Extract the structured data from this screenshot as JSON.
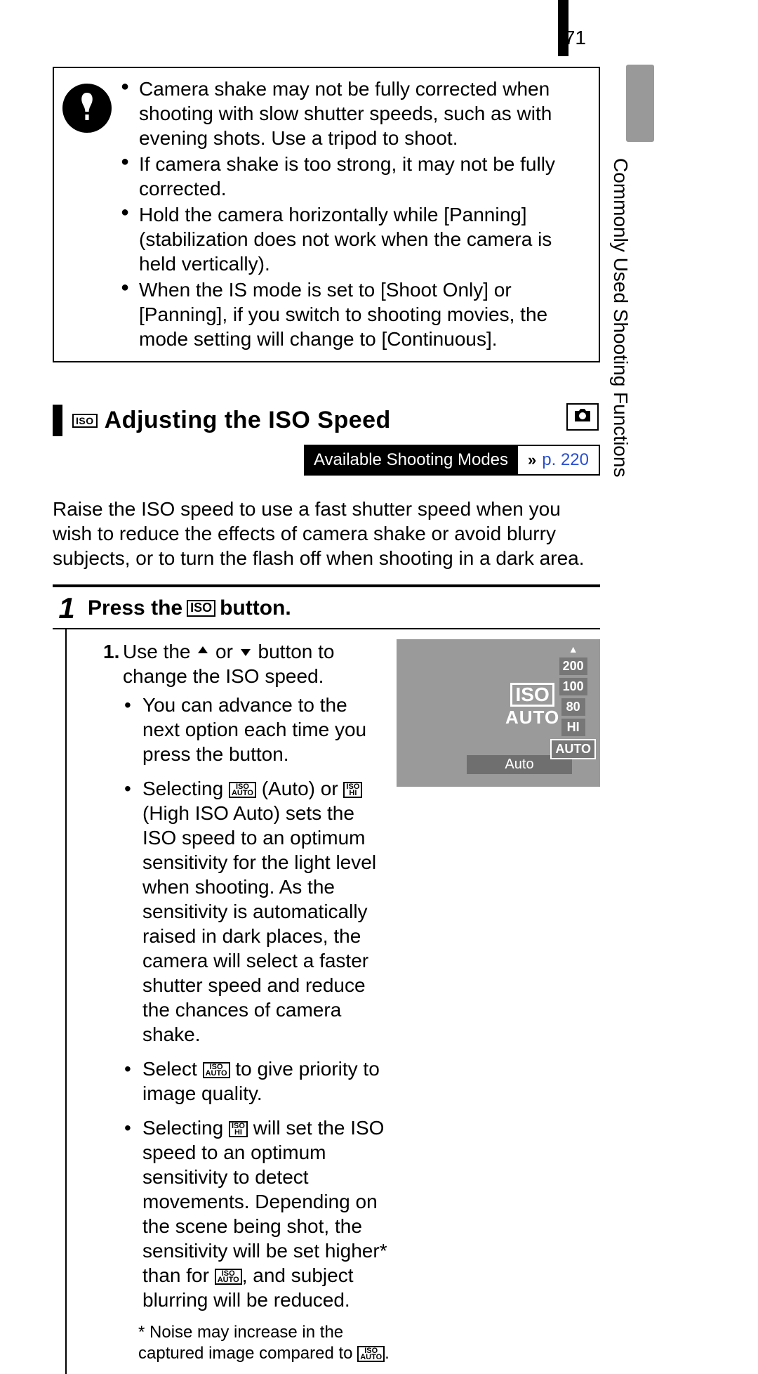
{
  "page_number": "71",
  "side_tab": "Commonly Used Shooting Functions",
  "caution": {
    "items": [
      "Camera shake may not be fully corrected when shooting with slow shutter speeds, such as with evening shots. Use a tripod to shoot.",
      "If camera shake is too strong, it may not be fully corrected.",
      "Hold the camera horizontally while [Panning] (stabilization does not work when the camera is held vertically).",
      "When the IS mode is set to [Shoot Only] or [Panning], if you switch to shooting movies, the mode setting will change to [Continuous]."
    ]
  },
  "section": {
    "iso_badge": "ISO",
    "title": "Adjusting the ISO Speed"
  },
  "modes": {
    "label": "Available Shooting Modes",
    "page_ref": "p. 220"
  },
  "intro": "Raise the ISO speed to use a fast shutter speed when you wish to reduce the effects of camera shake or avoid blurry subjects, or to turn the flash off when shooting in a dark area.",
  "step": {
    "number": "1",
    "title_pre": "Press the",
    "title_badge": "ISO",
    "title_post": "button.",
    "proc_num": "1.",
    "proc_pre": "Use the ",
    "proc_mid": " or ",
    "proc_post": " button to change the ISO speed.",
    "sub": [
      "You can advance to the next option each time you press the button.",
      {
        "pre": "Selecting ",
        "auto_top": "ISO",
        "auto_bot": "AUTO",
        "mid1": " (Auto) or ",
        "hi_top": "ISO",
        "hi_bot": "HI",
        "mid2": " (High ISO Auto) sets the ISO speed to an optimum sensitivity for the light level when shooting. As the sensitivity is automatically raised in dark places, the camera will select a faster shutter speed and reduce the chances of camera shake."
      },
      {
        "pre": "Select ",
        "auto_top": "ISO",
        "auto_bot": "AUTO",
        "post": " to give priority to image quality."
      },
      {
        "pre": "Selecting ",
        "hi_top": "ISO",
        "hi_bot": "HI",
        "mid": " will set the ISO speed to an optimum sensitivity to detect movements. Depending on the scene being shot, the sensitivity will be set higher* than for ",
        "auto_top": "ISO",
        "auto_bot": "AUTO",
        "post": ", and subject blurring will be reduced."
      }
    ],
    "footnote_pre": "* Noise may increase in the captured image compared to ",
    "footnote_top": "ISO",
    "footnote_bot": "AUTO",
    "footnote_post": "."
  },
  "lcd": {
    "iso_top": "ISO",
    "iso_bottom": "AUTO",
    "label": "Auto",
    "options": [
      "200",
      "100",
      "80",
      "HI",
      "AUTO"
    ],
    "selected": "AUTO"
  }
}
